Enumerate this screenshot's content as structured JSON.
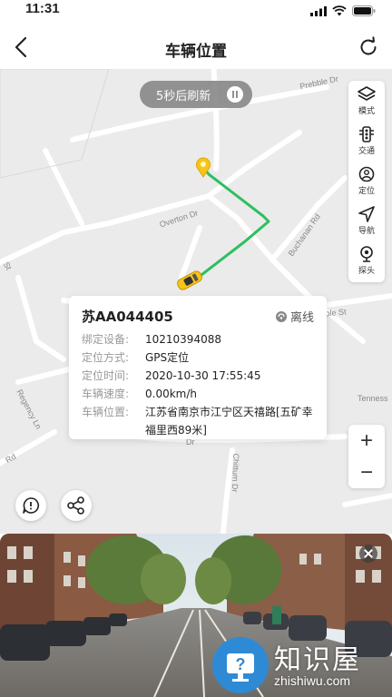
{
  "status_bar": {
    "time": "11:31"
  },
  "nav": {
    "title": "车辆位置",
    "back_icon": "back-arrow-icon",
    "refresh_icon": "refresh-icon"
  },
  "map": {
    "refresh_pill": {
      "text": "5秒后刷新",
      "icon": "pause-icon"
    },
    "road_labels": [
      "Prebble Dr",
      "Overton Dr",
      "Buchanan Rd",
      "Maple St",
      "Regency Ln",
      "Chittum Dr",
      "Tenness",
      "Hadin Rd",
      "St",
      "Dr",
      "Rd"
    ],
    "route_color": "#2fbf5f",
    "start_marker_color": "#f5c518",
    "vehicle_color": "#f5c518",
    "tools": [
      {
        "label": "模式",
        "icon": "layers-icon"
      },
      {
        "label": "交通",
        "icon": "traffic-light-icon"
      },
      {
        "label": "定位",
        "icon": "locate-person-icon"
      },
      {
        "label": "导航",
        "icon": "navigation-arrow-icon"
      },
      {
        "label": "探头",
        "icon": "camera-probe-icon"
      }
    ],
    "zoom": {
      "in": "+",
      "out": "−"
    }
  },
  "vehicle_card": {
    "plate": "苏AA044405",
    "status": "离线",
    "rows": [
      {
        "label": "绑定设备:",
        "value": "10210394088"
      },
      {
        "label": "定位方式:",
        "value": "GPS定位"
      },
      {
        "label": "定位时间:",
        "value": "2020-10-30 17:55:45"
      },
      {
        "label": "车辆速度:",
        "value": "0.00km/h"
      },
      {
        "label": "车辆位置:",
        "value": "江苏省南京市江宁区天禧路[五矿幸福里西89米]"
      }
    ]
  },
  "bottom_buttons": {
    "alert_icon": "alert-bubble-icon",
    "share_icon": "share-icon"
  },
  "watermark": {
    "cn": "知识屋",
    "en": "zhishiwu.com"
  }
}
